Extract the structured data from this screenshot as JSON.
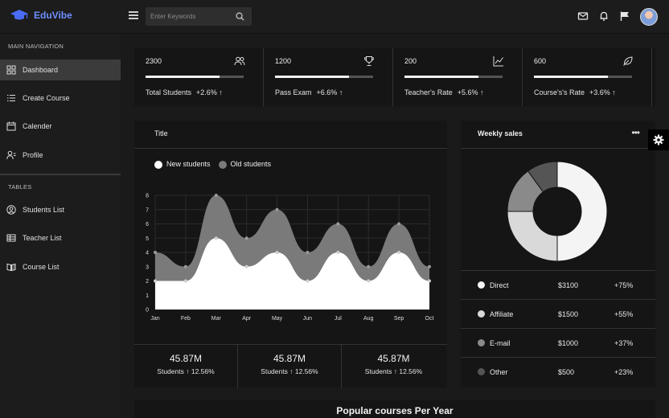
{
  "app": {
    "name": "EduVibe",
    "brand_color": "#4a6cf7"
  },
  "header": {
    "search": {
      "placeholder": "Enter Keywords",
      "value": ""
    },
    "icons": [
      "mail-icon",
      "bell-icon",
      "flag-icon"
    ]
  },
  "sidebar": {
    "main_label": "MAIN NAVIGATION",
    "tables_label": "TABLES",
    "main_items": [
      {
        "label": "Dashboard",
        "icon": "grid-icon",
        "active": true
      },
      {
        "label": "Create Course",
        "icon": "list-icon",
        "active": false
      },
      {
        "label": "Calender",
        "icon": "calendar-icon",
        "active": false
      },
      {
        "label": "Profile",
        "icon": "user-icon",
        "active": false
      }
    ],
    "table_items": [
      {
        "label": "Students List",
        "icon": "user-circle-icon"
      },
      {
        "label": "Teacher List",
        "icon": "table-icon"
      },
      {
        "label": "Course List",
        "icon": "book-icon"
      }
    ]
  },
  "stats": [
    {
      "value": "2300",
      "label": "Total Students",
      "change": "+2.6%",
      "progress": 0.75,
      "icon": "users-icon"
    },
    {
      "value": "1200",
      "label": "Pass Exam",
      "change": "+6.6%",
      "progress": 0.75,
      "icon": "trophy-icon"
    },
    {
      "value": "200",
      "label": "Teacher's Rate",
      "change": "+5.6%",
      "progress": 0.75,
      "icon": "line-chart-icon"
    },
    {
      "value": "600",
      "label": "Course's's Rate",
      "change": "+3.6%",
      "progress": 0.75,
      "icon": "leaf-icon"
    }
  ],
  "chart_card": {
    "title": "Title",
    "footer": [
      {
        "value": "45.87M",
        "label": "Students",
        "change": "12.56%"
      },
      {
        "value": "45.87M",
        "label": "Students",
        "change": "12.56%"
      },
      {
        "value": "45.87M",
        "label": "Students",
        "change": "12.56%"
      }
    ]
  },
  "chart_data": {
    "type": "area",
    "categories": [
      "Jan",
      "Feb",
      "Mar",
      "Apr",
      "May",
      "Jun",
      "Jul",
      "Aug",
      "Sep",
      "Oct"
    ],
    "series": [
      {
        "name": "New students",
        "color": "#ffffff",
        "values": [
          2,
          2,
          5,
          3,
          4,
          2,
          4,
          2,
          4,
          2
        ]
      },
      {
        "name": "Old students",
        "color": "#7a7a7a",
        "values": [
          4,
          3,
          8,
          5,
          7,
          4,
          6,
          3,
          6,
          3
        ]
      }
    ],
    "yticks": [
      0,
      1,
      2,
      3,
      4,
      5,
      6,
      7,
      8
    ],
    "ylim": [
      0,
      8
    ],
    "grid": true,
    "legend": "top-left"
  },
  "sales": {
    "title": "Weekly sales",
    "menu": "•••",
    "donut": [
      {
        "value": 50,
        "color": "#f4f4f4"
      },
      {
        "value": 25,
        "color": "#d9d9d9"
      },
      {
        "value": 15,
        "color": "#8a8a8a"
      },
      {
        "value": 10,
        "color": "#555555"
      }
    ],
    "rows": [
      {
        "name": "Direct",
        "amount": "$3100",
        "change": "+75%",
        "color": "#f4f4f4"
      },
      {
        "name": "Affiliate",
        "amount": "$1500",
        "change": "+55%",
        "color": "#d9d9d9"
      },
      {
        "name": "E-mail",
        "amount": "$1000",
        "change": "+37%",
        "color": "#8a8a8a"
      },
      {
        "name": "Other",
        "amount": "$500",
        "change": "+23%",
        "color": "#555555"
      }
    ]
  },
  "bottom": {
    "title": "Popular courses Per Year"
  }
}
